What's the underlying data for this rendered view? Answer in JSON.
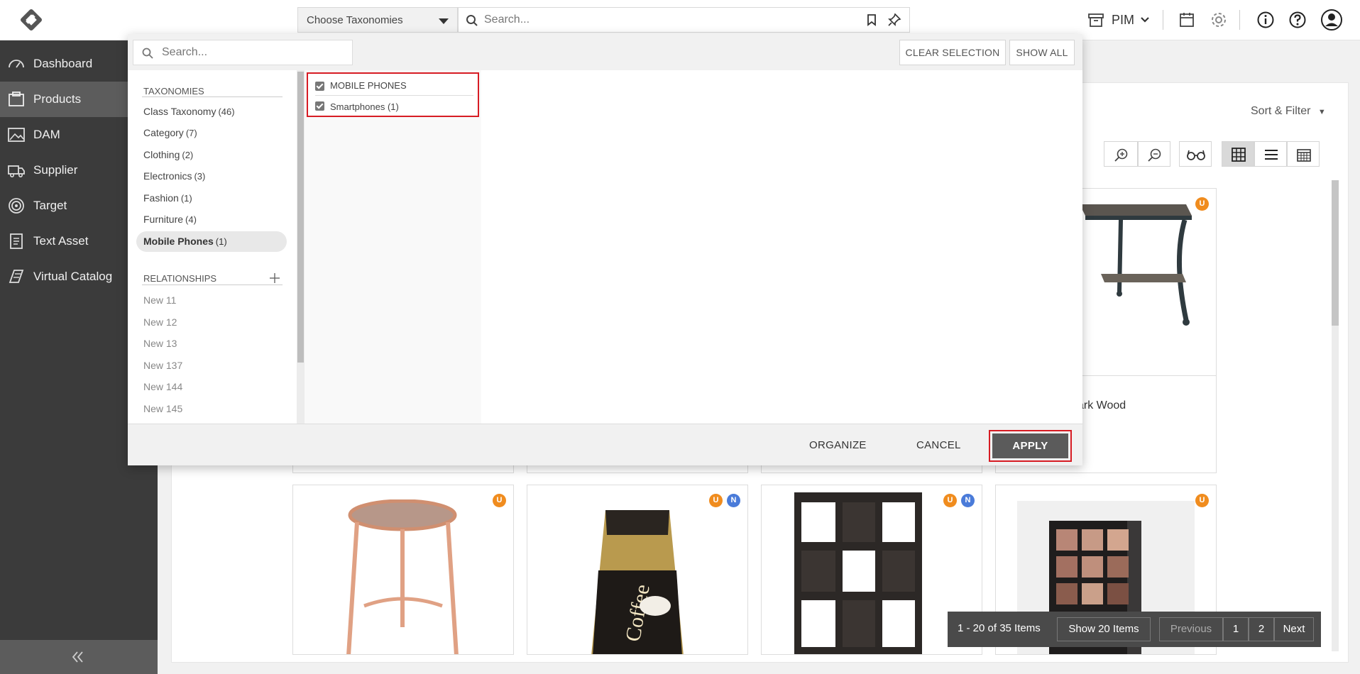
{
  "topbar": {
    "taxonomy_select": "Choose Taxonomies",
    "search_placeholder": "Search...",
    "module_label": "PIM"
  },
  "sidebar": {
    "items": [
      {
        "label": "Dashboard",
        "icon": "dashboard-icon"
      },
      {
        "label": "Products",
        "icon": "products-icon",
        "active": true
      },
      {
        "label": "DAM",
        "icon": "image-icon"
      },
      {
        "label": "Supplier",
        "icon": "truck-icon"
      },
      {
        "label": "Target",
        "icon": "target-icon"
      },
      {
        "label": "Text Asset",
        "icon": "document-icon"
      },
      {
        "label": "Virtual Catalog",
        "icon": "catalog-icon"
      }
    ],
    "collapse_icon": "double-chevron-left-icon"
  },
  "products": {
    "sort_filter_label": "Sort & Filter",
    "partial_card_title": "ark Wood",
    "badges": [
      "U",
      "U",
      "U",
      "N",
      "U",
      "N",
      "U"
    ]
  },
  "pagination": {
    "info": "1 - 20 of 35 Items",
    "show_label": "Show 20 Items",
    "previous": "Previous",
    "pages": [
      "1",
      "2"
    ],
    "next": "Next"
  },
  "popup": {
    "search_placeholder": "Search...",
    "clear_selection": "CLEAR SELECTION",
    "show_all": "SHOW ALL",
    "taxonomies_header": "TAXONOMIES",
    "taxonomies": [
      {
        "name": "Class Taxonomy",
        "count": "(46)"
      },
      {
        "name": "Category",
        "count": "(7)"
      },
      {
        "name": "Clothing",
        "count": "(2)"
      },
      {
        "name": "Electronics",
        "count": "(3)"
      },
      {
        "name": "Fashion",
        "count": "(1)"
      },
      {
        "name": "Furniture",
        "count": "(4)"
      },
      {
        "name": "Mobile Phones",
        "count": "(1)",
        "active": true
      }
    ],
    "relationships_header": "RELATIONSHIPS",
    "relationships": [
      "New 11",
      "New 12",
      "New 13",
      "New 137",
      "New 144",
      "New 145"
    ],
    "selected_group": "MOBILE PHONES",
    "selected_item_name": "Smartphones",
    "selected_item_count": "(1)",
    "organize": "ORGANIZE",
    "cancel": "CANCEL",
    "apply": "APPLY"
  },
  "colors": {
    "sidebar_bg": "#3b3b3b",
    "sidebar_active": "#5c5c5c",
    "highlight_red": "#d71c24",
    "badge_u": "#f08c1e",
    "badge_n": "#4a7bd9"
  }
}
